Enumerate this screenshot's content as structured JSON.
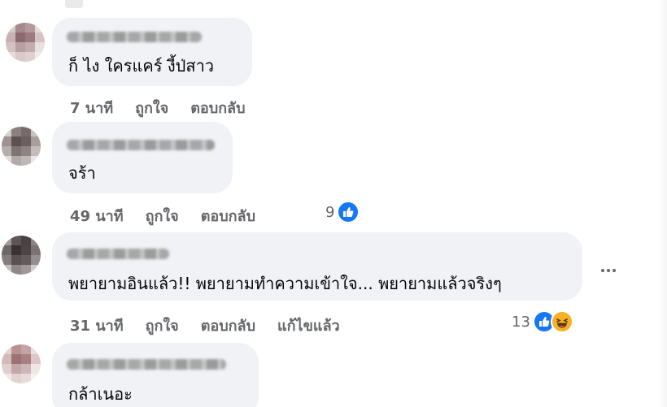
{
  "comments": [
    {
      "text": "ก็ ไง ใครแคร์ งี้ป่สาว",
      "time": "7 นาที",
      "like_label": "ถูกใจ",
      "reply_label": "ตอบกลับ"
    },
    {
      "text": "จร้า",
      "time": "49 นาที",
      "like_label": "ถูกใจ",
      "reply_label": "ตอบกลับ",
      "reaction_count": "9",
      "reactions": [
        "like-icon"
      ]
    },
    {
      "text": "พยายามอินแล้ว!! พยายามทำความเข้าใจ... พยายามแล้วจริงๆ",
      "time": "31 นาที",
      "like_label": "ถูกใจ",
      "reply_label": "ตอบกลับ",
      "edited_label": "แก้ไขแล้ว",
      "reaction_count": "13",
      "reactions": [
        "like-icon",
        "haha-icon"
      ]
    },
    {
      "text": "กล้าเนอะ"
    }
  ],
  "colors": {
    "bubble": "#f0f2f5",
    "secondary_text": "#65676b",
    "like_blue": "#1877f2",
    "haha_yellow": "#f7b125"
  }
}
